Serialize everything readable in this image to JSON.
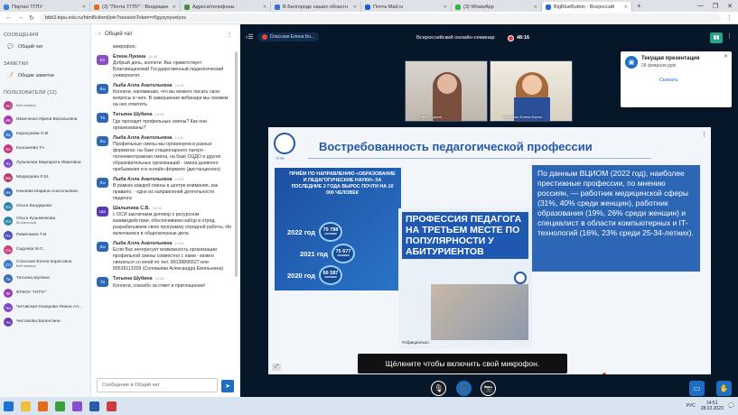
{
  "browser": {
    "tabs": [
      {
        "label": "Портал ТГПУ",
        "color": "#3b7dd8",
        "active": false
      },
      {
        "label": "(3) \"Почта ТГПУ\" : Входящие",
        "color": "#e26b24",
        "active": false
      },
      {
        "label": "Адреса/телефоны",
        "color": "#4a8f3f",
        "active": false
      },
      {
        "label": "В Белгороде наших областн",
        "color": "#3a6fc9",
        "active": false
      },
      {
        "label": "Почта Mail.ru",
        "color": "#1a5ed1",
        "active": false
      },
      {
        "label": "(3) WhatsApp",
        "color": "#2bb741",
        "active": false
      },
      {
        "label": "BigBlueButton - Всероссий",
        "color": "#2a6ad6",
        "active": true
      }
    ],
    "url": "bbb3.tspu.edu.ru/html5client/join?sessionToken=r5gyzyxyvetyvs"
  },
  "sidebar": {
    "messages_header": "СООБЩЕНИЯ",
    "public_chat": "Общий чат",
    "notes_header": "ЗАМЕТКИ",
    "shared_notes": "Общие заметки",
    "users_header": "ПОЛЬЗОВАТЕЛИ (22)",
    "users": [
      {
        "initials": "Ан",
        "name": "",
        "sub": "Веб камера",
        "color": "#b8418a"
      },
      {
        "initials": "Ив",
        "name": "Иванченко Ирина Васильевна",
        "sub": "",
        "color": "#a83dae"
      },
      {
        "initials": "Ка",
        "name": "Карасукова О.В.",
        "sub": "",
        "color": "#3b78c8"
      },
      {
        "initials": "Ко",
        "name": "Кононеева ТА",
        "sub": "",
        "color": "#c23b7f"
      },
      {
        "initials": "Лу",
        "name": "Лукьянова Маргарита Ивановна",
        "sub": "",
        "color": "#7a46c4"
      },
      {
        "initials": "Ме",
        "name": "Медведева Л.М.",
        "sub": "",
        "color": "#b53b6d"
      },
      {
        "initials": "Не",
        "name": "Некаева Марина Анатольевна",
        "sub": "",
        "color": "#3e6db8"
      },
      {
        "initials": "Ол",
        "name": "Ольга Бондарева",
        "sub": "",
        "color": "#2d83a8"
      },
      {
        "initials": "Ол",
        "name": "Ольга Кузьменкова",
        "sub": "Мобильный",
        "color": "#2d83a8"
      },
      {
        "initials": "Пе",
        "name": "Пеменкина Т.И",
        "sub": "",
        "color": "#4b4fb6"
      },
      {
        "initials": "Са",
        "name": "Сидоева М.С.",
        "sub": "",
        "color": "#c8417a"
      },
      {
        "initials": "Сп",
        "name": "Спасская Елена борисовна",
        "sub": "Веб камера",
        "color": "#3b78c8"
      },
      {
        "initials": "Та",
        "name": "Татьяна Шубина",
        "sub": "",
        "color": "#3e6db8"
      },
      {
        "initials": "Фг",
        "name": "ФГБОУ \"НГПУ\"",
        "sub": "",
        "color": "#9c3bb5"
      },
      {
        "initials": "Чи",
        "name": "Читовская-Назарова Янина Ал...",
        "sub": "",
        "color": "#7a46c4"
      },
      {
        "initials": "Чи",
        "name": "Чистякова Валентина",
        "sub": "",
        "color": "#6c3ab0"
      }
    ]
  },
  "chat": {
    "title": "Общий чат",
    "top_fragment": "микрофон.",
    "messages": [
      {
        "initials": "Ел",
        "color": "#8a4fc7",
        "name": "Елена Лукина",
        "time": "14:26",
        "text": "Добрый день, коллеги. Вас приветствует Благовещенский Государственный педагогический университет.",
        "more": []
      },
      {
        "initials": "Лы",
        "color": "#2e66b6",
        "name": "Лыба Алла Анатольевна",
        "time": "14:26",
        "text": "Коллеги, напоминаю, что вы можете писать свои вопросы в чате. В завершение вебинара мы сможем на них ответить",
        "more": []
      },
      {
        "initials": "Та",
        "color": "#2e66b6",
        "name": "Татьяна Шубина",
        "time": "14:30",
        "text": "Где проходят профильные смены? Как они организованы?",
        "more": []
      },
      {
        "initials": "Лы",
        "color": "#2e66b6",
        "name": "Лыба Алла Анатольевна",
        "time": "14:32",
        "text": "Профильные смены мы организуем в разных форматах: на базе стационарного лагеря - полноментражная смена, на базе ОЦДО и других образовательных организаций - смена дневного пребывания и в онлайн-формате (дистанционно)",
        "more": []
      },
      {
        "initials": "Лы",
        "color": "#2e66b6",
        "name": "Лыба Алла Анатольевна",
        "time": "14:33",
        "text": "В рамках каждой смены в центре внимания, как правило, - одно из направлений деятельности педагога",
        "more": []
      },
      {
        "initials": "Ша",
        "color": "#5b3ab8",
        "name": "Шалыпина С.В.",
        "time": "14:33",
        "text": "с ОСИ заключаем договор о ресурсном взаимодействии, обеспечиваем набор в отряд, разрабатываем свою программу отрядной работы. Но включаемся в общелагерные дела",
        "more": []
      },
      {
        "initials": "Лы",
        "color": "#2e66b6",
        "name": "Лыба Алла Анатольевна",
        "time": "14:34",
        "text": "Если Вас интересует возможность организации профильной смены совместно с нами - можно связаться со мной по тел. 89138895527 или 89539113209 (Соловьёва Александра Евгеньевна)",
        "more": []
      },
      {
        "initials": "Та",
        "color": "#2e66b6",
        "name": "Татьяна Шубина",
        "time": "14:35",
        "text": "Коллеги, спасибо за ответ и приглашение!",
        "more": []
      }
    ],
    "input_placeholder": "Сообщение в Общий чат"
  },
  "meeting": {
    "presenter_pill": "Спасская Елена Бо...",
    "title": "Всероссийский онлайн-семинар",
    "timer": "48:16",
    "videos": [
      {
        "label": "Елена Лукина"
      },
      {
        "label": "Спасская Елена Борис..."
      }
    ],
    "notification": {
      "title": "Текущая презентация",
      "file": "28 февраля.pptx",
      "action": "Скачать"
    },
    "mic_banner": "Щёлкните   чтобы включить свой микрофон."
  },
  "slide": {
    "title": "Востребованность педагогической профессии",
    "info_heading": "ПРИЁМ ПО НАПРАВЛЕНИЮ «ОБРАЗОВАНИЕ И ПЕДАГОГИЧЕСКИЕ НАУКИ» ЗА ПОСЛЕДНИЕ 2 ГОДА ВЫРОС ПОЧТИ НА 10 000 ЧЕЛОВЕК",
    "years": [
      {
        "year": "2022 год",
        "value": "75 788",
        "unit": "ЧЕЛОВЕК"
      },
      {
        "year": "2021 год",
        "value": "75 677",
        "unit": "ЧЕЛОВЕК"
      },
      {
        "year": "2020 год",
        "value": "66 587",
        "unit": "ЧЕЛОВЕК"
      }
    ],
    "image_heading": "ПРОФЕССИЯ ПЕДАГОГА НА ТРЕТЬЕМ МЕСТЕ ПО ПОПУЛЯРНОСТИ У АБИТУРИЕНТОВ",
    "image_caption": "#Официально",
    "blue_text": "По данным ВЦИОМ (2022 год), наиболее престижные профессии, по мнению россиян, — работник медицинской сферы (31%, 40% среди женщин), работник образования (19%, 26% среди женщин) и специалист в области компьютерных и IT-технологий (16%, 23% среди 25-34-летних).",
    "logo_text": "ТГПУ"
  },
  "taskbar": {
    "time": "14:51",
    "date": "28.02.2023",
    "lang": "РУС"
  }
}
